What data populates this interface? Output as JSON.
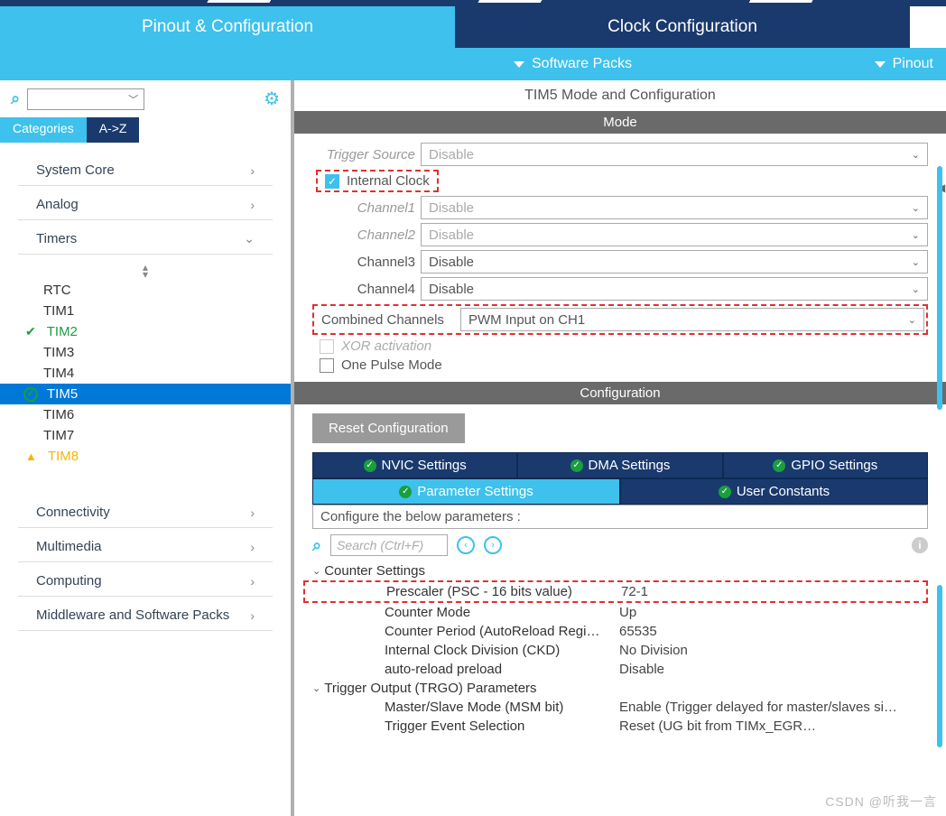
{
  "tabs": {
    "pinout": "Pinout & Configuration",
    "clock": "Clock Configuration"
  },
  "subbar": {
    "software": "Software Packs",
    "pinout": "Pinout"
  },
  "catTabs": {
    "categories": "Categories",
    "az": "A->Z"
  },
  "categories": {
    "system": "System Core",
    "analog": "Analog",
    "timers": "Timers",
    "connectivity": "Connectivity",
    "multimedia": "Multimedia",
    "computing": "Computing",
    "middleware": "Middleware and Software Packs"
  },
  "timers": {
    "rtc": "RTC",
    "tim1": "TIM1",
    "tim2": "TIM2",
    "tim3": "TIM3",
    "tim4": "TIM4",
    "tim5": "TIM5",
    "tim6": "TIM6",
    "tim7": "TIM7",
    "tim8": "TIM8"
  },
  "panel": {
    "title": "TIM5 Mode and Configuration",
    "mode": "Mode",
    "config": "Configuration"
  },
  "mode": {
    "trigger_label": "Trigger Source",
    "trigger_val": "Disable",
    "internal_clock": "Internal Clock",
    "ch1_label": "Channel1",
    "ch1_val": "Disable",
    "ch2_label": "Channel2",
    "ch2_val": "Disable",
    "ch3_label": "Channel3",
    "ch3_val": "Disable",
    "ch4_label": "Channel4",
    "ch4_val": "Disable",
    "combined_label": "Combined Channels",
    "combined_val": "PWM Input on CH1",
    "xor": "XOR activation",
    "one_pulse": "One Pulse Mode"
  },
  "config": {
    "reset": "Reset Configuration",
    "nvic": "NVIC Settings",
    "dma": "DMA Settings",
    "gpio": "GPIO Settings",
    "param": "Parameter Settings",
    "user": "User Constants",
    "configure_text": "Configure the below parameters :",
    "search_ph": "Search (Ctrl+F)",
    "counter_group": "Counter Settings",
    "prescaler": "Prescaler (PSC - 16 bits value)",
    "prescaler_val": "72-1",
    "counter_mode": "Counter Mode",
    "counter_mode_val": "Up",
    "counter_period": "Counter Period (AutoReload Regi…",
    "counter_period_val": "65535",
    "ckd": "Internal Clock Division (CKD)",
    "ckd_val": "No Division",
    "preload": "auto-reload preload",
    "preload_val": "Disable",
    "trgo_group": "Trigger Output (TRGO) Parameters",
    "msm": "Master/Slave Mode (MSM bit)",
    "msm_val": "Enable (Trigger delayed for master/slaves si…",
    "tes": "Trigger Event Selection",
    "tes_val": "Reset (UG bit from TIMx_EGR…"
  },
  "watermark": "CSDN @听我一言"
}
